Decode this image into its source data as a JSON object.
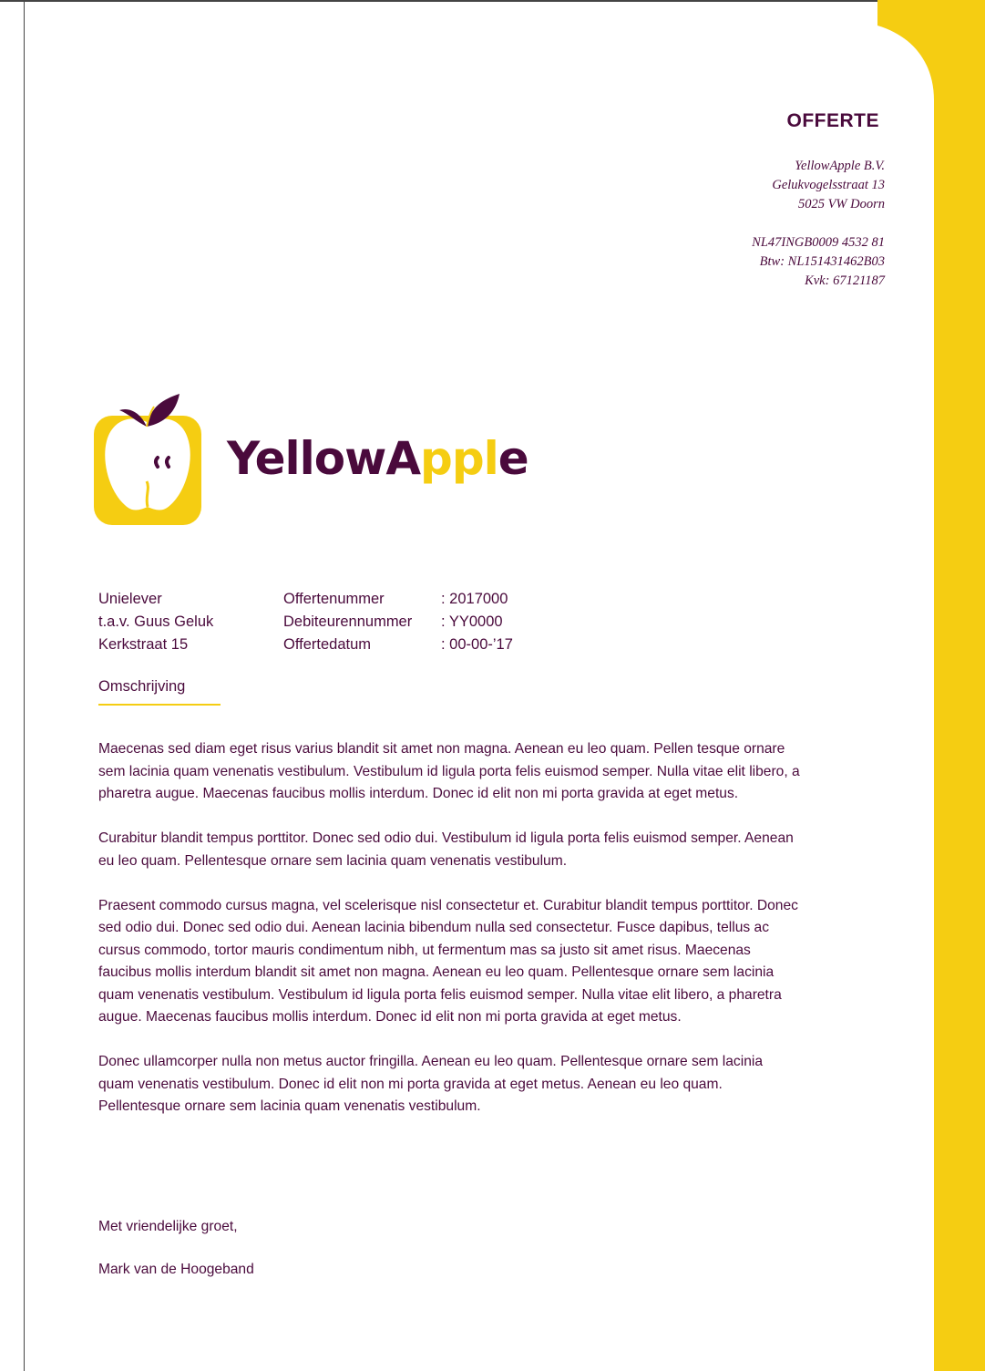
{
  "header": {
    "title": "OFFERTE",
    "company_name": "YellowApple B.V.",
    "street": "Gelukvogelsstraat 13",
    "postal_city": "5025 VW Doorn",
    "iban": "NL47INGB0009 4532 81",
    "btw": "Btw: NL151431462B03",
    "kvk": "Kvk: 67121187"
  },
  "brand": {
    "part1": "YellowA",
    "part2": "ppl",
    "part3": "e",
    "icon": "apple-logo-icon"
  },
  "recipient": {
    "company": "Unielever",
    "attention": "t.a.v. Guus Geluk",
    "street": "Kerkstraat 15"
  },
  "meta": [
    {
      "label": "Offertenummer",
      "value": ": 2017000"
    },
    {
      "label": "Debiteurennummer",
      "value": ": YY0000"
    },
    {
      "label": "Offertedatum",
      "value": ": 00-00-’17"
    }
  ],
  "section_label": "Omschrijving",
  "paragraphs": [
    "Maecenas sed diam eget risus varius blandit sit amet non magna. Aenean eu leo quam. Pellen tesque ornare sem lacinia quam venenatis vestibulum. Vestibulum id ligula porta felis euismod semper. Nulla vitae elit libero, a pharetra augue. Maecenas faucibus mollis interdum. Donec id elit non mi porta gravida at eget metus.",
    "Curabitur blandit tempus porttitor. Donec sed odio dui. Vestibulum id ligula porta felis euismod semper. Aenean eu leo quam. Pellentesque ornare sem lacinia quam venenatis vestibulum.",
    "Praesent commodo cursus magna, vel scelerisque nisl consectetur et. Curabitur blandit tempus porttitor. Donec sed odio dui. Donec sed odio dui. Aenean lacinia bibendum nulla sed consectetur. Fusce dapibus, tellus ac cursus commodo, tortor mauris condimentum nibh, ut fermentum mas sa justo sit amet risus. Maecenas faucibus mollis interdum blandit sit amet non magna. Aenean eu leo quam. Pellentesque ornare sem lacinia quam venenatis vestibulum. Vestibulum id ligula porta felis euismod semper. Nulla vitae elit libero, a pharetra augue. Maecenas faucibus mollis interdum. Donec id elit non mi porta gravida at eget metus.",
    "Donec ullamcorper nulla non metus auctor fringilla. Aenean eu leo quam. Pellentesque ornare sem lacinia quam venenatis vestibulum. Donec id elit non mi porta gravida at eget metus. Aenean eu leo quam. Pellentesque ornare sem lacinia quam venenatis vestibulum."
  ],
  "closing": "Met vriendelijke groet,",
  "signature": "Mark van de Hoogeband",
  "colors": {
    "accent": "#f5cd12",
    "text": "#4a0a3c"
  }
}
